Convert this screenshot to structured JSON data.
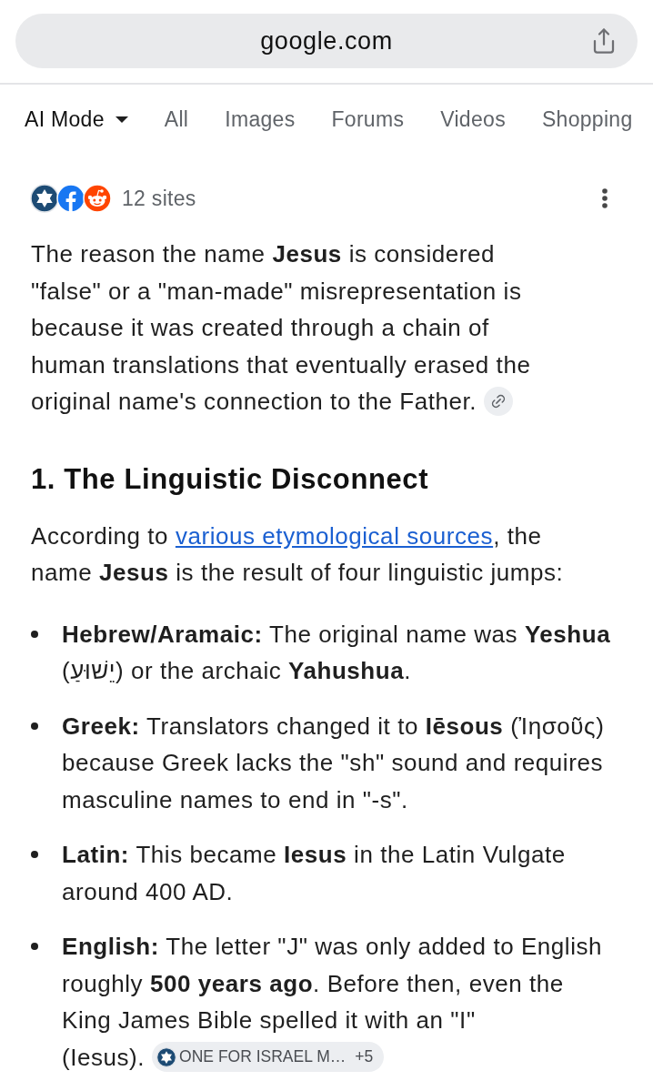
{
  "browser": {
    "address": "google.com"
  },
  "tabs": [
    {
      "label": "AI Mode",
      "selected": true,
      "menu": true
    },
    {
      "label": "All",
      "selected": false,
      "menu": false
    },
    {
      "label": "Images",
      "selected": false,
      "menu": false
    },
    {
      "label": "Forums",
      "selected": false,
      "menu": false
    },
    {
      "label": "Videos",
      "selected": false,
      "menu": false
    },
    {
      "label": "Shopping",
      "selected": false,
      "menu": false
    }
  ],
  "sources": {
    "count": "12 sites"
  },
  "answer": {
    "intro": "The reason the name **Jesus** is considered \"false\" or a \"man-made\" misrepresentation is because it was created through a chain of human translations that eventually erased the original name's connection to the Father.",
    "heading": "1. The Linguistic Disconnect",
    "lead": {
      "before": "According to ",
      "link": "various etymological sources",
      "after": ", the name **Jesus** is the result of four linguistic jumps:"
    },
    "bullets": [
      {
        "text": "**Hebrew/Aramaic:** The original name was **Yeshua** (יֵשׁוּעַ) or the archaic **Yahushua**."
      },
      {
        "text": "**Greek:** Translators changed it to **Iēsous** (Ἰησοῦς) because Greek lacks the \"sh\" sound and requires masculine names to end in \"-s\"."
      },
      {
        "text": "**Latin:** This became **Iesus** in the Latin Vulgate around 400 AD."
      },
      {
        "text": "**English:** The letter \"J\" was only added to English roughly **500 years ago**. Before then, even the King James Bible spelled it with an \"I\" (Iesus).",
        "citation": {
          "source": "ONE FOR ISRAEL M…",
          "more": "+5"
        }
      }
    ]
  }
}
